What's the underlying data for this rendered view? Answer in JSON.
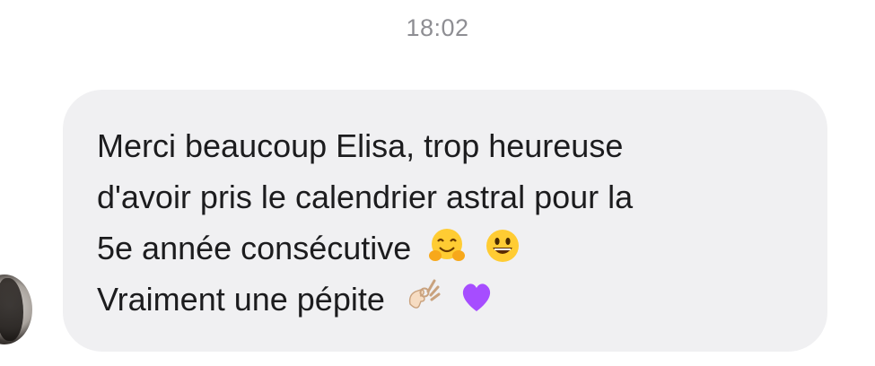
{
  "conversation": {
    "timestamp": "18:02",
    "message": {
      "lines": [
        "Merci beaucoup Elisa, trop heureuse",
        "d'avoir pris le calendrier astral pour la",
        "5e année consécutive",
        "Vraiment une pépite"
      ],
      "emojis": {
        "line3": [
          "hugging-face-emoji",
          "grinning-face-emoji"
        ],
        "line4": [
          "ok-hand-emoji",
          "purple-heart-emoji"
        ]
      }
    }
  },
  "colors": {
    "bubble_background": "#f0f0f2",
    "timestamp_text": "#8e8e93",
    "message_text": "#1c1c1e",
    "heart": "#a64dff"
  }
}
